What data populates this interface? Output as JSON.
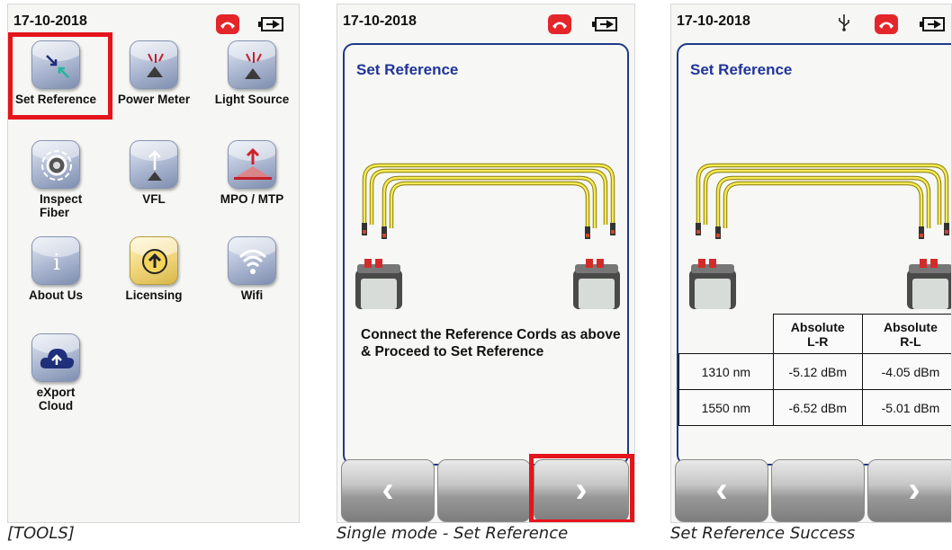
{
  "screens": [
    {
      "date": "17-10-2018",
      "tools": [
        {
          "label": "Set Reference"
        },
        {
          "label": "Power Meter"
        },
        {
          "label": "Light Source"
        },
        {
          "label": "Inspect\nFiber"
        },
        {
          "label": "VFL"
        },
        {
          "label": "MPO / MTP"
        },
        {
          "label": "About Us"
        },
        {
          "label": "Licensing"
        },
        {
          "label": "Wifi"
        },
        {
          "label": "eXport\nCloud"
        }
      ],
      "caption": "[TOOLS]"
    },
    {
      "date": "17-10-2018",
      "title": "Set Reference",
      "instruction": "Connect the Reference Cords as above & Proceed to Set Reference",
      "buttons": {
        "back": "‹",
        "next": "›"
      },
      "caption": "Single mode - Set Reference"
    },
    {
      "date": "17-10-2018",
      "title": "Set Reference",
      "table": {
        "headers": [
          "Absolute\nL-R",
          "Absolute\nR-L"
        ],
        "rows": [
          {
            "wavelength": "1310 nm",
            "lr": "-5.12 dBm",
            "rl": "-4.05 dBm"
          },
          {
            "wavelength": "1550 nm",
            "lr": "-6.52 dBm",
            "rl": "-5.01 dBm"
          }
        ]
      },
      "buttons": {
        "back": "‹",
        "next": "›"
      },
      "caption": "Set Reference Success"
    }
  ],
  "icons": {
    "phone": "phone-hangup-icon",
    "battery": "battery-icon",
    "usb": "usb-icon"
  },
  "colors": {
    "highlight": "#e4151b",
    "panel_border": "#1f3a8a",
    "title": "#20349a",
    "phone": "#e4262b",
    "cable": "#f2e64a"
  }
}
